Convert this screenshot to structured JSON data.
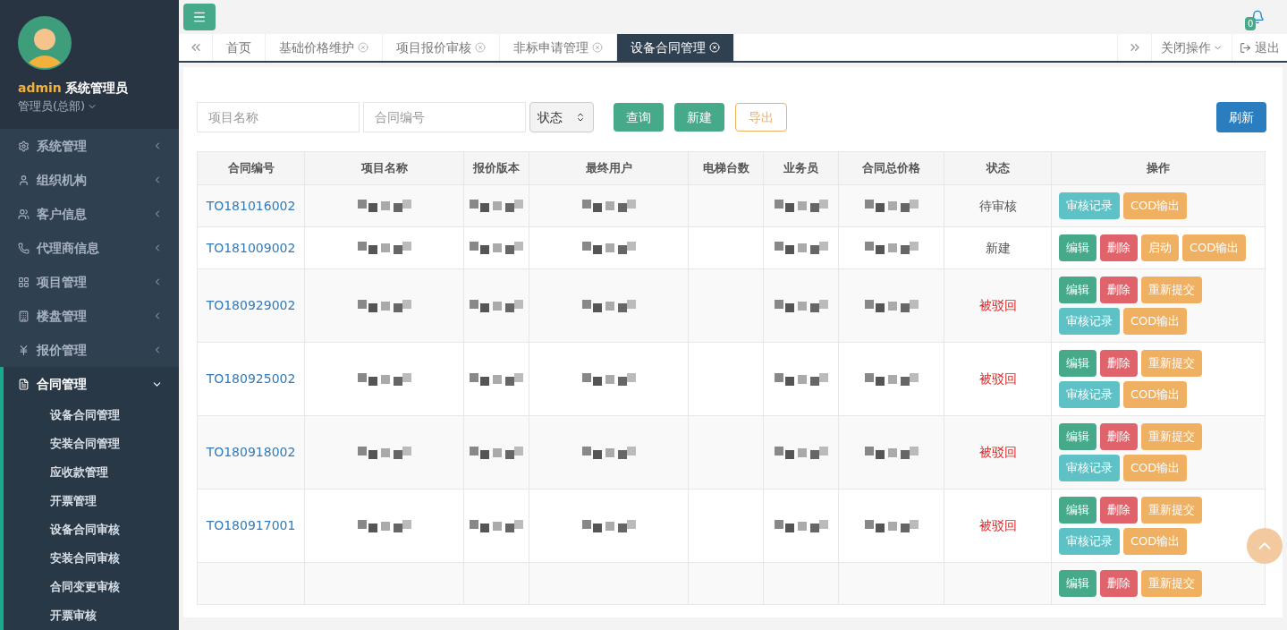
{
  "user": {
    "name": "admin",
    "role": "系统管理员",
    "org": "管理员(总部)"
  },
  "menu": [
    {
      "label": "系统管理",
      "expanded": false
    },
    {
      "label": "组织机构",
      "expanded": false
    },
    {
      "label": "客户信息",
      "expanded": false
    },
    {
      "label": "代理商信息",
      "expanded": false
    },
    {
      "label": "项目管理",
      "expanded": false
    },
    {
      "label": "楼盘管理",
      "expanded": false
    },
    {
      "label": "报价管理",
      "expanded": false
    },
    {
      "label": "合同管理",
      "expanded": true,
      "children": [
        {
          "label": "设备合同管理"
        },
        {
          "label": "安装合同管理"
        },
        {
          "label": "应收款管理"
        },
        {
          "label": "开票管理"
        },
        {
          "label": "设备合同审核"
        },
        {
          "label": "安装合同审核"
        },
        {
          "label": "合同变更审核"
        },
        {
          "label": "开票审核"
        }
      ]
    }
  ],
  "notifications": {
    "count": "0"
  },
  "tabs": [
    {
      "label": "首页",
      "selected": false,
      "closable": false
    },
    {
      "label": "基础价格维护",
      "selected": false,
      "closable": true
    },
    {
      "label": "项目报价审核",
      "selected": false,
      "closable": true
    },
    {
      "label": "非标申请管理",
      "selected": false,
      "closable": true
    },
    {
      "label": "设备合同管理",
      "selected": true,
      "closable": true
    }
  ],
  "tab_tools": {
    "close_menu": "关闭操作",
    "logout": "退出"
  },
  "filters": {
    "project_name": {
      "placeholder": "项目名称"
    },
    "contract_no": {
      "placeholder": "合同编号"
    },
    "status": {
      "value": "状态"
    },
    "buttons": [
      {
        "label": "查询",
        "kind": "primary"
      },
      {
        "label": "新建",
        "kind": "primary"
      },
      {
        "label": "导出",
        "kind": "outline"
      }
    ],
    "refresh": "刷新"
  },
  "table": {
    "columns": [
      "合同编号",
      "项目名称",
      "报价版本",
      "最终用户",
      "电梯台数",
      "业务员",
      "合同总价格",
      "状态",
      "操作"
    ],
    "rows": [
      {
        "contract_no": "TO181016002",
        "status": "待审核",
        "rejected": false,
        "actions": [
          [
            {
              "label": "审核记录",
              "kind": "info"
            },
            {
              "label": "COD输出",
              "kind": "warning"
            }
          ]
        ]
      },
      {
        "contract_no": "TO181009002",
        "status": "新建",
        "rejected": false,
        "actions": [
          [
            {
              "label": "编辑",
              "kind": "success"
            },
            {
              "label": "删除",
              "kind": "danger"
            },
            {
              "label": "启动",
              "kind": "warning"
            },
            {
              "label": "COD输出",
              "kind": "warning"
            }
          ]
        ]
      },
      {
        "contract_no": "TO180929002",
        "status": "被驳回",
        "rejected": true,
        "actions": [
          [
            {
              "label": "编辑",
              "kind": "success"
            },
            {
              "label": "删除",
              "kind": "danger"
            },
            {
              "label": "重新提交",
              "kind": "warning"
            }
          ],
          [
            {
              "label": "审核记录",
              "kind": "info"
            },
            {
              "label": "COD输出",
              "kind": "warning"
            }
          ]
        ]
      },
      {
        "contract_no": "TO180925002",
        "status": "被驳回",
        "rejected": true,
        "actions": [
          [
            {
              "label": "编辑",
              "kind": "success"
            },
            {
              "label": "删除",
              "kind": "danger"
            },
            {
              "label": "重新提交",
              "kind": "warning"
            }
          ],
          [
            {
              "label": "审核记录",
              "kind": "info"
            },
            {
              "label": "COD输出",
              "kind": "warning"
            }
          ]
        ]
      },
      {
        "contract_no": "TO180918002",
        "status": "被驳回",
        "rejected": true,
        "actions": [
          [
            {
              "label": "编辑",
              "kind": "success"
            },
            {
              "label": "删除",
              "kind": "danger"
            },
            {
              "label": "重新提交",
              "kind": "warning"
            }
          ],
          [
            {
              "label": "审核记录",
              "kind": "info"
            },
            {
              "label": "COD输出",
              "kind": "warning"
            }
          ]
        ]
      },
      {
        "contract_no": "TO180917001",
        "status": "被驳回",
        "rejected": true,
        "actions": [
          [
            {
              "label": "编辑",
              "kind": "success"
            },
            {
              "label": "删除",
              "kind": "danger"
            },
            {
              "label": "重新提交",
              "kind": "warning"
            }
          ],
          [
            {
              "label": "审核记录",
              "kind": "info"
            },
            {
              "label": "COD输出",
              "kind": "warning"
            }
          ]
        ]
      },
      {
        "actions": [
          [
            {
              "label": "编辑",
              "kind": "success"
            },
            {
              "label": "删除",
              "kind": "danger"
            },
            {
              "label": "重新提交",
              "kind": "warning"
            }
          ]
        ]
      }
    ]
  }
}
